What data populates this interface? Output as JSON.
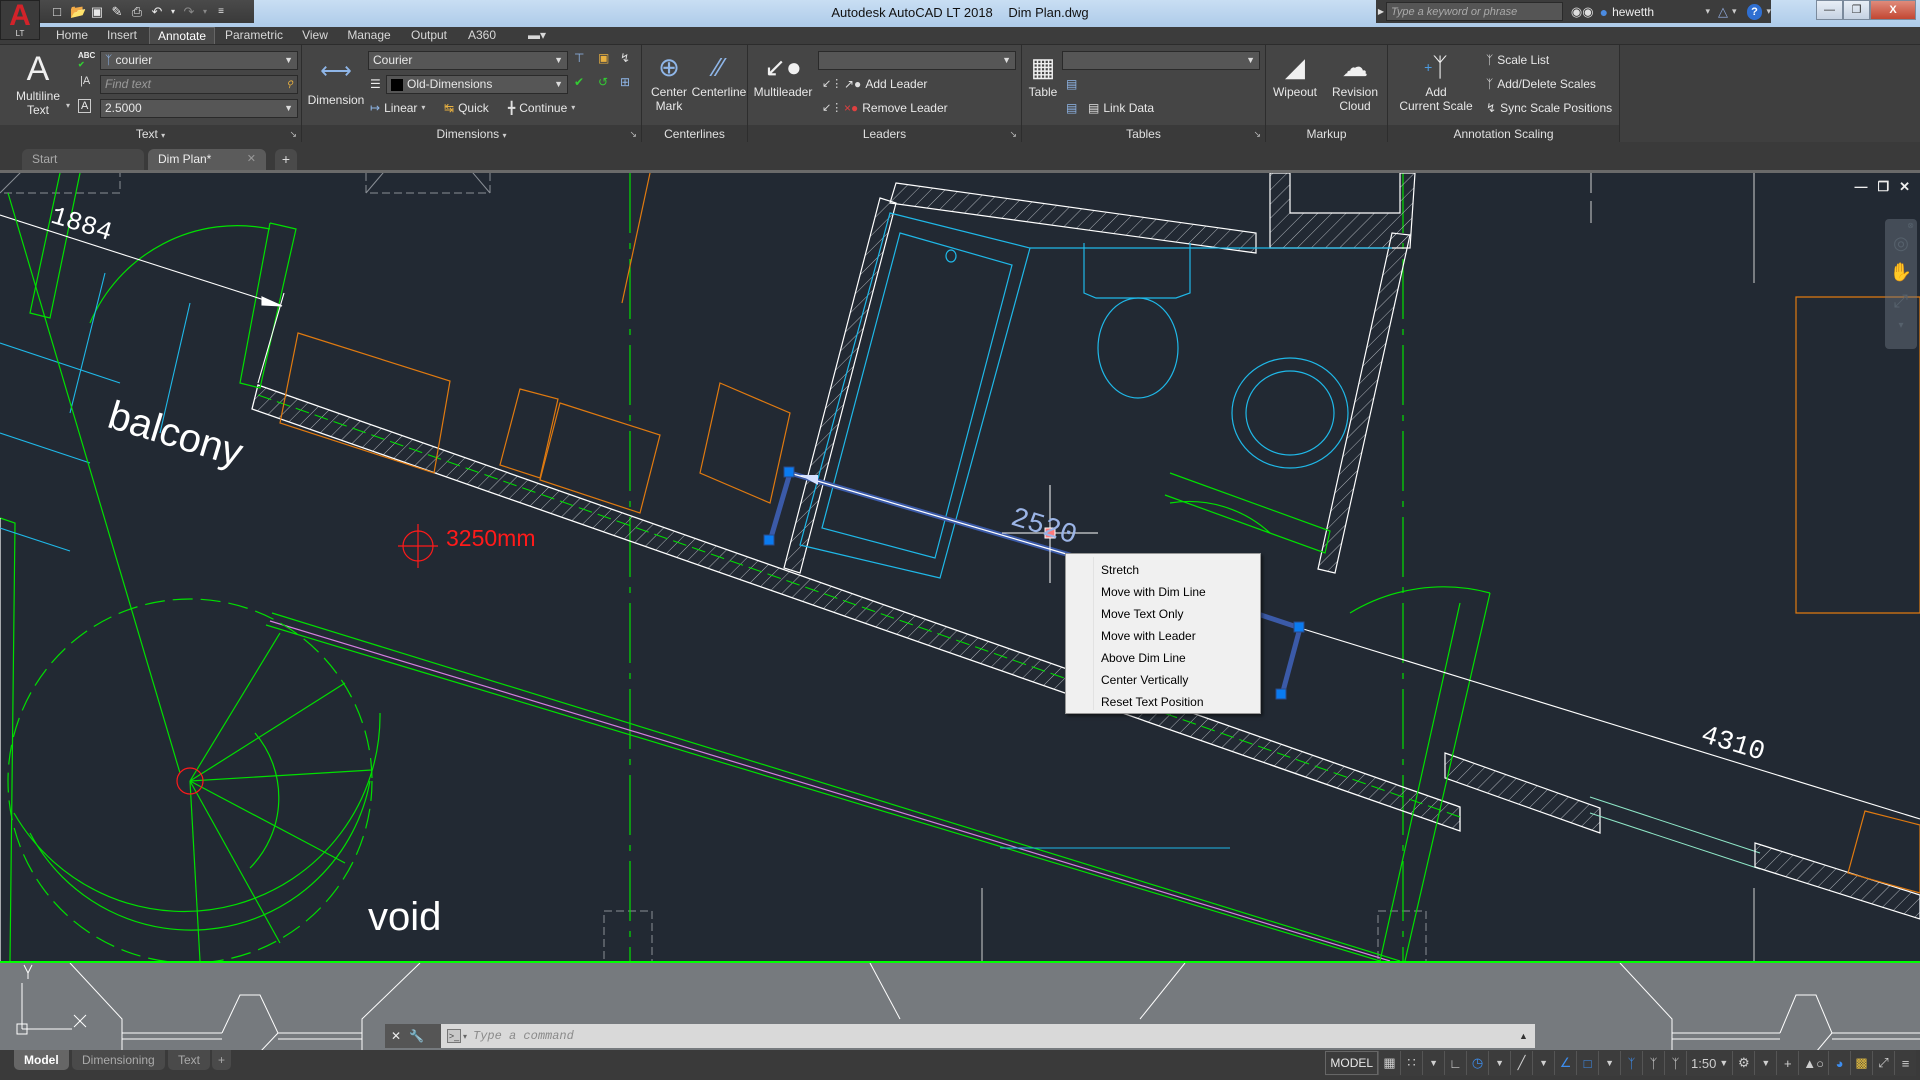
{
  "app": {
    "title": "Autodesk AutoCAD LT 2018",
    "document": "Dim Plan.dwg",
    "app_button_letter": "A",
    "app_button_badge": "LT"
  },
  "quick_access": [
    "new-icon",
    "open-icon",
    "save-icon",
    "save-as-icon",
    "print-icon",
    "undo-icon",
    "redo-icon",
    "customize-icon"
  ],
  "search": {
    "placeholder": "Type a keyword or phrase"
  },
  "user": {
    "name": "hewetth"
  },
  "ribbon_tabs": [
    "Home",
    "Insert",
    "Annotate",
    "Parametric",
    "View",
    "Manage",
    "Output",
    "A360"
  ],
  "active_ribbon_tab": "Annotate",
  "ribbon": {
    "text_panel": {
      "title": "Text",
      "multiline_text": [
        "Multiline",
        "Text"
      ],
      "text_style": "courier",
      "find_text_placeholder": "Find text",
      "text_height": "2.5000"
    },
    "dimensions_panel": {
      "title": "Dimensions",
      "dimension_label": "Dimension",
      "dim_style": "Courier",
      "dim_layer": "Old-Dimensions",
      "linear": "Linear",
      "quick": "Quick",
      "continue": "Continue"
    },
    "centerlines_panel": {
      "title": "Centerlines",
      "center_mark": [
        "Center",
        "Mark"
      ],
      "centerline": "Centerline"
    },
    "leaders_panel": {
      "title": "Leaders",
      "multileader": "Multileader",
      "leader_style": "",
      "add_leader": "Add Leader",
      "remove_leader": "Remove Leader"
    },
    "tables_panel": {
      "title": "Tables",
      "table": "Table",
      "table_style": "",
      "link_data": "Link Data"
    },
    "markup_panel": {
      "title": "Markup",
      "wipeout": "Wipeout",
      "revision_cloud": [
        "Revision",
        "Cloud"
      ]
    },
    "annotation_scaling_panel": {
      "title": "Annotation Scaling",
      "add_current_scale": [
        "Add",
        "Current Scale"
      ],
      "scale_list": "Scale List",
      "add_delete_scales": "Add/Delete Scales",
      "sync_scale_positions": "Sync Scale Positions"
    }
  },
  "doc_tabs": [
    {
      "label": "Start",
      "active": false
    },
    {
      "label": "Dim Plan*",
      "active": true
    }
  ],
  "drawing": {
    "labels": {
      "dim_1884": "1884",
      "balcony": "balcony",
      "radius_note": "3250mm",
      "dim_2520": "2520",
      "dim_4310": "4310",
      "void": "void"
    },
    "colors": {
      "background": "#222933",
      "walls": "#00e000",
      "fixtures": "#1fb8e8",
      "furniture": "#e07a10",
      "dimension": "#ffffff",
      "grip": "#0a7bf0",
      "note": "#ff1a1a",
      "magenta": "#d57fe0"
    }
  },
  "context_menu": {
    "items": [
      "Stretch",
      "Move with Dim Line",
      "Move Text Only",
      "Move with Leader",
      "Above Dim Line",
      "Center Vertically",
      "Reset Text Position"
    ]
  },
  "command_line": {
    "placeholder": "Type a command"
  },
  "layout_tabs": [
    {
      "label": "Model",
      "active": true
    },
    {
      "label": "Dimensioning",
      "active": false
    },
    {
      "label": "Text",
      "active": false
    }
  ],
  "status_bar": {
    "model_label": "MODEL",
    "annotation_scale": "1:50"
  }
}
